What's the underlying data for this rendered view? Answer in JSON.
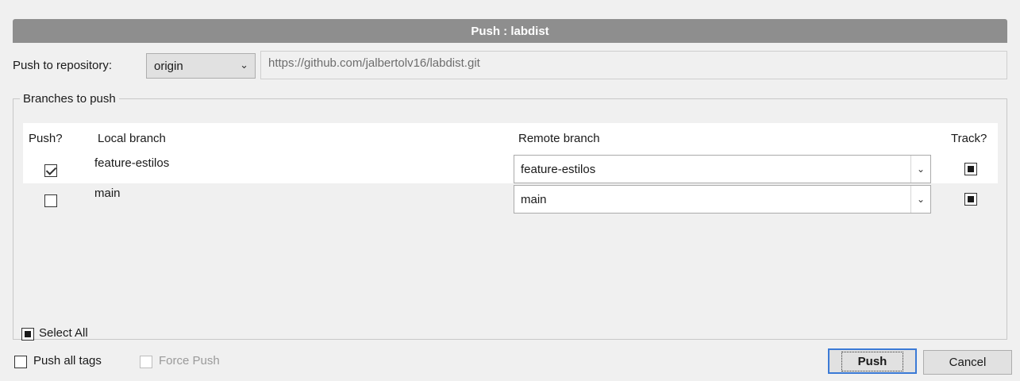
{
  "window": {
    "title": "Push : labdist"
  },
  "repo": {
    "label": "Push to repository:",
    "selected": "origin",
    "url": "https://github.com/jalbertolv16/labdist.git"
  },
  "branches": {
    "group_label": "Branches to push",
    "columns": {
      "push": "Push?",
      "local": "Local branch",
      "remote": "Remote branch",
      "track": "Track?"
    },
    "rows": [
      {
        "push": true,
        "local": "feature-estilos",
        "remote": "feature-estilos",
        "track": true
      },
      {
        "push": false,
        "local": "main",
        "remote": "main",
        "track": true
      }
    ],
    "select_all_label": "Select All"
  },
  "options": {
    "push_all_tags": "Push all tags",
    "force_push": "Force Push"
  },
  "buttons": {
    "push": "Push",
    "cancel": "Cancel"
  }
}
